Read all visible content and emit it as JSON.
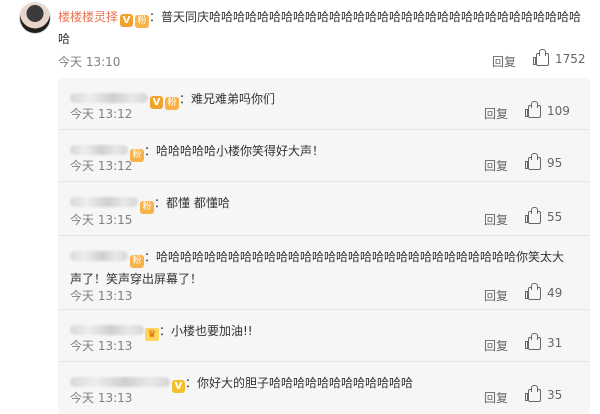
{
  "main_comment": {
    "username": "楼楼楼灵择",
    "badge_text": "V",
    "content": "：普天同庆哈哈哈哈哈哈哈哈哈哈哈哈哈哈哈哈哈哈哈哈哈哈哈哈哈哈哈哈哈哈哈哈",
    "time": "今天 13:10",
    "reply_label": "回复",
    "likes": "1752"
  },
  "replies": [
    {
      "content": "：难兄难弟吗你们",
      "time": "今天 13:12",
      "reply_label": "回复",
      "likes": "109"
    },
    {
      "content": "：哈哈哈哈哈小楼你笑得好大声！",
      "time": "今天 13:12",
      "reply_label": "回复",
      "likes": "95"
    },
    {
      "content": "：都懂 都懂哈",
      "time": "今天 13:15",
      "reply_label": "回复",
      "likes": "55"
    },
    {
      "content": "：哈哈哈哈哈哈哈哈哈哈哈哈哈哈哈哈哈哈哈哈哈哈哈哈哈哈哈哈哈哈你笑太大声了！笑声穿出屏幕了！",
      "time": "今天 13:13",
      "reply_label": "回复",
      "likes": "49"
    },
    {
      "content": "：小楼也要加油!!",
      "time": "今天 13:13",
      "reply_label": "回复",
      "likes": "31"
    },
    {
      "content": "：你好大的胆子哈哈哈哈哈哈哈哈哈哈哈哈",
      "time": "今天 13:13",
      "reply_label": "回复",
      "likes": "35"
    }
  ]
}
